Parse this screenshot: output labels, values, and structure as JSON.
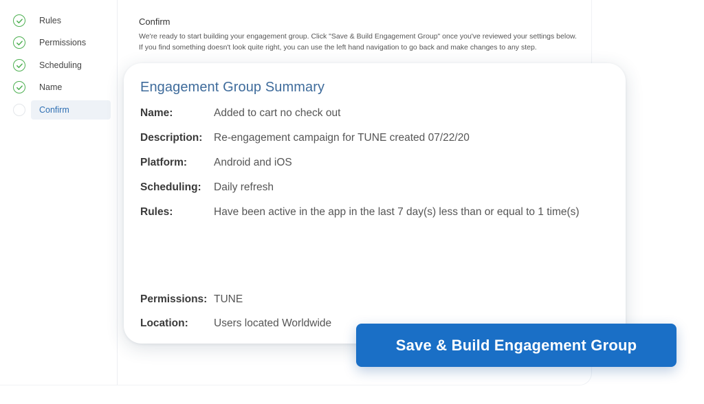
{
  "sidebar": {
    "steps": [
      {
        "label": "Rules",
        "status": "done"
      },
      {
        "label": "Permissions",
        "status": "done"
      },
      {
        "label": "Scheduling",
        "status": "done"
      },
      {
        "label": "Name",
        "status": "done"
      },
      {
        "label": "Confirm",
        "status": "current"
      }
    ]
  },
  "header": {
    "title": "Confirm",
    "intro": "We're ready to start building your engagement group. Click \"Save & Build Engagement Group\" once you've reviewed your settings below. If you find something doesn't look quite right, you can use the left hand navigation to go back and make changes to any step."
  },
  "summary": {
    "title": "Engagement Group Summary",
    "rows": [
      {
        "key": "Name:",
        "value": "Added to cart no check out"
      },
      {
        "key": "Description:",
        "value": "Re-engagement campaign for TUNE created 07/22/20"
      },
      {
        "key": "Platform:",
        "value": "Android and iOS"
      },
      {
        "key": "Scheduling:",
        "value": "Daily refresh"
      },
      {
        "key": "Rules:",
        "value": "Have been active in the app in the last 7 day(s) less than or equal to 1 time(s)"
      },
      {
        "key": "Permissions:",
        "value": "TUNE"
      },
      {
        "key": "Location:",
        "value": "Users located Worldwide"
      }
    ]
  },
  "cta": {
    "label": "Save & Build Engagement Group"
  },
  "colors": {
    "accent": "#1a6fc6",
    "success": "#4caf50",
    "title": "#3e6b9b"
  },
  "icons": {
    "done": "check-circle-icon",
    "current": "empty-circle-icon"
  }
}
